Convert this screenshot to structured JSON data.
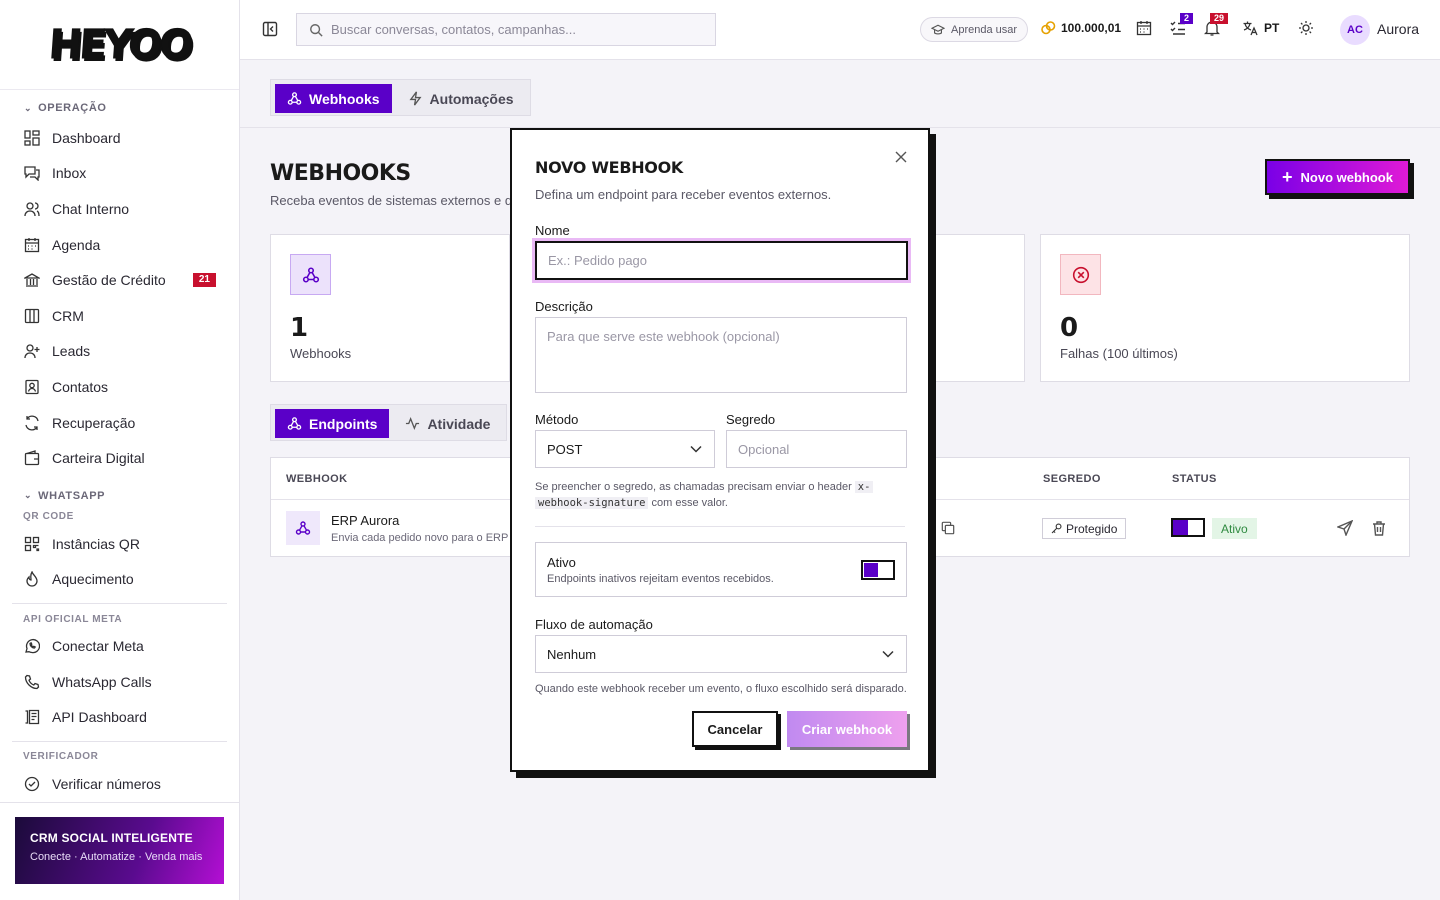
{
  "brand": {
    "logo": "HEYOO"
  },
  "sidebar": {
    "sections": [
      {
        "title": "OPERAÇÃO",
        "items": [
          {
            "label": "Dashboard",
            "icon": "dashboard-icon"
          },
          {
            "label": "Inbox",
            "icon": "inbox-icon"
          },
          {
            "label": "Chat Interno",
            "icon": "users-icon"
          },
          {
            "label": "Agenda",
            "icon": "calendar-icon"
          },
          {
            "label": "Gestão de Crédito",
            "icon": "bank-icon",
            "badge": "21"
          },
          {
            "label": "CRM",
            "icon": "columns-icon"
          },
          {
            "label": "Leads",
            "icon": "user-plus-icon"
          },
          {
            "label": "Contatos",
            "icon": "contact-icon"
          },
          {
            "label": "Recuperação",
            "icon": "refresh-icon"
          },
          {
            "label": "Carteira Digital",
            "icon": "wallet-icon"
          }
        ]
      },
      {
        "title": "WHATSAPP",
        "subtitle": "QR CODE",
        "items": [
          {
            "label": "Instâncias QR",
            "icon": "qr-icon"
          },
          {
            "label": "Aquecimento",
            "icon": "flame-icon"
          }
        ]
      },
      {
        "subtitle": "API OFICIAL META",
        "items": [
          {
            "label": "Conectar Meta",
            "icon": "whatsapp-icon"
          },
          {
            "label": "WhatsApp Calls",
            "icon": "phone-icon"
          },
          {
            "label": "API Dashboard",
            "icon": "api-icon"
          }
        ]
      },
      {
        "subtitle": "VERIFICADOR",
        "items": [
          {
            "label": "Verificar números",
            "icon": "check-circle-icon"
          }
        ]
      }
    ],
    "promo": {
      "title": "CRM SOCIAL INTELIGENTE",
      "text": "Conecte · Automatize · Venda mais"
    }
  },
  "topbar": {
    "search_placeholder": "Buscar conversas, contatos, campanhas...",
    "learn_label": "Aprenda usar",
    "credits": "100.000,01",
    "tasks_badge": "2",
    "notifications_badge": "29",
    "language": "PT",
    "avatar_initials": "AC",
    "user_name": "Aurora"
  },
  "main": {
    "tabs": [
      "Webhooks",
      "Automações"
    ],
    "title": "WEBHOOKS",
    "subtitle": "Receba eventos de sistemas externos e dis",
    "new_button": "Novo webhook",
    "stats": [
      {
        "value": "1",
        "label": "Webhooks"
      },
      {
        "value": "0",
        "label": "Falhas (100 últimos)"
      }
    ],
    "subtabs": [
      "Endpoints",
      "Atividade"
    ],
    "table": {
      "headers": {
        "webhook": "WEBHOOK",
        "secret": "SEGREDO",
        "status": "STATUS"
      },
      "rows": [
        {
          "name": "ERP Aurora",
          "description": "Envia cada pedido novo para o ERP d",
          "secret": "Protegido",
          "status": "Ativo",
          "active": true
        }
      ]
    }
  },
  "modal": {
    "title": "NOVO WEBHOOK",
    "subtitle": "Defina um endpoint para receber eventos externos.",
    "name_label": "Nome",
    "name_placeholder": "Ex.: Pedido pago",
    "desc_label": "Descrição",
    "desc_placeholder": "Para que serve este webhook (opcional)",
    "method_label": "Método",
    "method_value": "POST",
    "secret_label": "Segredo",
    "secret_placeholder": "Opcional",
    "secret_hint_pre": "Se preencher o segredo, as chamadas precisam enviar o header ",
    "secret_hint_code1": "x-",
    "secret_hint_code2": "webhook-signature",
    "secret_hint_post": " com esse valor.",
    "active_title": "Ativo",
    "active_desc": "Endpoints inativos rejeitam eventos recebidos.",
    "active_on": true,
    "flow_label": "Fluxo de automação",
    "flow_value": "Nenhum",
    "flow_hint": "Quando este webhook receber um evento, o fluxo escolhido será disparado.",
    "cancel": "Cancelar",
    "create": "Criar webhook"
  },
  "colors": {
    "primary": "#5a00c8",
    "accent": "#e01ad6",
    "danger": "#c8102e",
    "success": "#2f8a40"
  }
}
